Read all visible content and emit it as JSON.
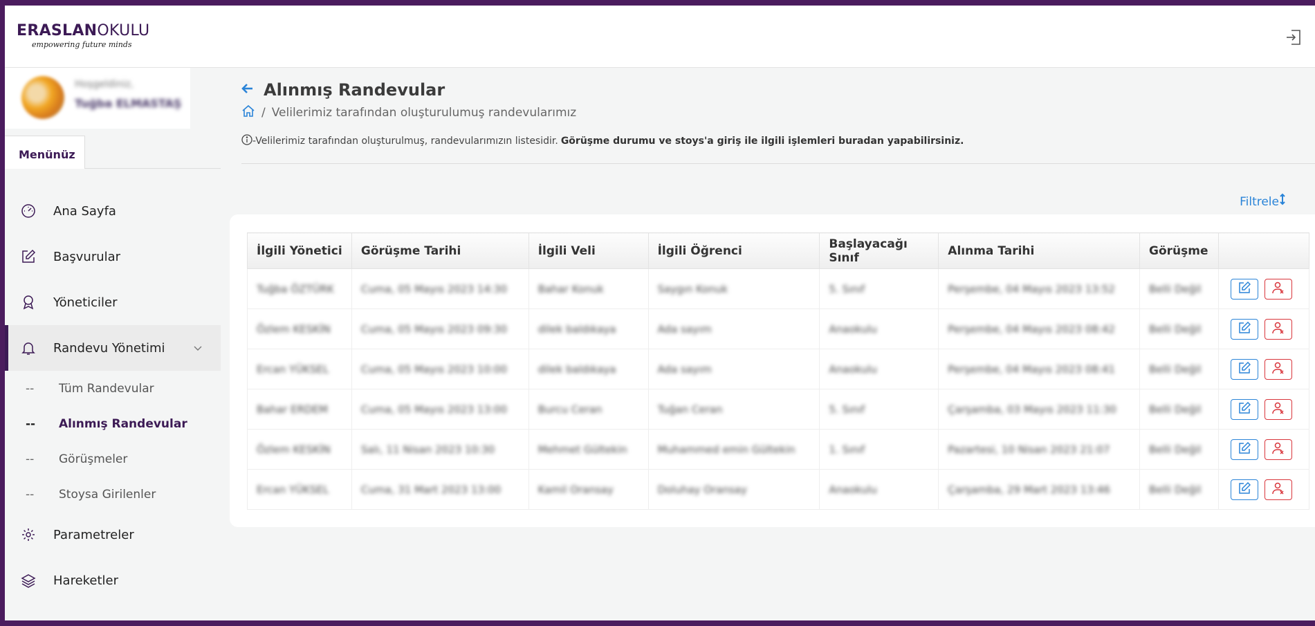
{
  "brand": {
    "name_bold": "ERASLAN",
    "name_light": "OKULU",
    "tagline": "empowering future minds"
  },
  "profile": {
    "greeting": "Hoşgeldiniz,",
    "name": "Tuğba ELMASTAŞ"
  },
  "menu": {
    "tab_label": "Menünüz",
    "items": [
      {
        "label": "Ana Sayfa",
        "icon": "speedometer-icon"
      },
      {
        "label": "Başvurular",
        "icon": "edit-icon"
      },
      {
        "label": "Yöneticiler",
        "icon": "award-icon"
      },
      {
        "label": "Randevu Yönetimi",
        "icon": "bell-icon"
      },
      {
        "label": "Parametreler",
        "icon": "gear-icon"
      },
      {
        "label": "Hareketler",
        "icon": "layers-icon"
      }
    ],
    "sub_items": [
      {
        "dash": "--",
        "label": "Tüm Randevular"
      },
      {
        "dash": "--",
        "label": "Alınmış Randevular"
      },
      {
        "dash": "--",
        "label": "Görüşmeler"
      },
      {
        "dash": "--",
        "label": "Stoysa Girilenler"
      }
    ]
  },
  "page": {
    "title": "Alınmış Randevular",
    "breadcrumb_sep": "/",
    "breadcrumb": "Velilerimiz tarafından oluşturulumuş randevularımız",
    "info_text": "-Velilerimiz tarafından oluşturulmuş, randevularımızın listesidir.",
    "info_bold": "Görüşme durumu ve stoys'a giriş ile ilgili işlemleri buradan yapabilirsiniz.",
    "filter_label": "Filtrele"
  },
  "table": {
    "headers": [
      "İlgili Yönetici",
      "Görüşme Tarihi",
      "İlgili Veli",
      "İlgili Öğrenci",
      "Başlayacağı Sınıf",
      "Alınma Tarihi",
      "Görüşme"
    ],
    "rows": [
      [
        "Tuğba ÖZTÜRK",
        "Cuma, 05 Mayıs 2023 14:30",
        "Bahar Konuk",
        "Saygın Konuk",
        "5. Sınıf",
        "Perşembe, 04 Mayıs 2023 13:52",
        "Belli Değil"
      ],
      [
        "Özlem KESKİN",
        "Cuma, 05 Mayıs 2023 09:30",
        "dilek baldıkaya",
        "Ada sayım",
        "Anaokulu",
        "Perşembe, 04 Mayıs 2023 08:42",
        "Belli Değil"
      ],
      [
        "Ercan YÜKSEL",
        "Cuma, 05 Mayıs 2023 10:00",
        "dilek baldıkaya",
        "Ada sayım",
        "Anaokulu",
        "Perşembe, 04 Mayıs 2023 08:41",
        "Belli Değil"
      ],
      [
        "Bahar ERDEM",
        "Cuma, 05 Mayıs 2023 13:00",
        "Burcu Ceran",
        "Tuğan Ceran",
        "5. Sınıf",
        "Çarşamba, 03 Mayıs 2023 11:30",
        "Belli Değil"
      ],
      [
        "Özlem KESKİN",
        "Salı, 11 Nisan 2023 10:30",
        "Mehmet Gültekin",
        "Muhammed emin Gültekin",
        "1. Sınıf",
        "Pazartesi, 10 Nisan 2023 21:07",
        "Belli Değil"
      ],
      [
        "Ercan YÜKSEL",
        "Cuma, 31 Mart 2023 13:00",
        "Kamil Oransay",
        "Doluhay Oransay",
        "Anaokulu",
        "Çarşamba, 29 Mart 2023 13:46",
        "Belli Değil"
      ]
    ]
  },
  "colors": {
    "brand": "#3c1a55",
    "accent_blue": "#2a84d8",
    "danger_red": "#d9353b"
  }
}
